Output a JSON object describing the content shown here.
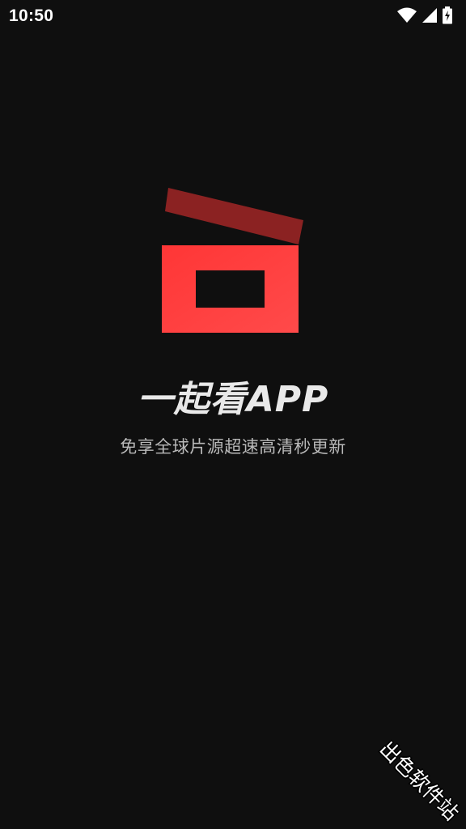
{
  "status_bar": {
    "time": "10:50",
    "icons": [
      "wifi-icon",
      "cellular-signal-icon",
      "battery-charging-icon"
    ]
  },
  "splash": {
    "logo_icon": "clapperboard-logo-icon",
    "title": "一起看APP",
    "tagline": "免享全球片源超速高清秒更新"
  },
  "watermark": {
    "text": "出色软件站"
  },
  "colors": {
    "background": "#0f0f0f",
    "brand_red": "#ff3b3b",
    "brand_dark_red": "#8b2222",
    "title_text": "#e9e9e9",
    "tagline_text": "#b9b9b9"
  }
}
